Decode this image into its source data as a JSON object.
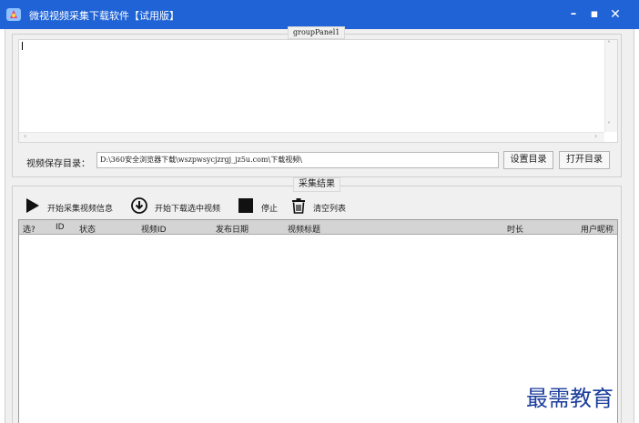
{
  "window": {
    "title": "微视视频采集下载软件【试用版】",
    "controls": {
      "minimize": "–",
      "maximize": "▪",
      "close": "✕"
    }
  },
  "group1": {
    "caption": "groupPanel1",
    "textarea_value": ""
  },
  "save_dir": {
    "label": "视频保存目录：",
    "value": "D:\\360安全浏览器下载\\wszpwsycjzrgj_jz5u.com\\下载视频\\",
    "set_button": "设置目录",
    "open_button": "打开目录"
  },
  "results": {
    "caption": "采集结果",
    "toolbar": {
      "start_collect": "开始采集视频信息",
      "start_download": "开始下载选中视频",
      "stop": "停止",
      "clear": "清空列表"
    },
    "columns": [
      "选?",
      "ID",
      "状态",
      "视频ID",
      "发布日期",
      "视频标题",
      "时长",
      "用户昵称"
    ]
  },
  "watermark": "最需教育",
  "colors": {
    "titlebar": "#1f63d6",
    "watermark": "#1b3d9c"
  },
  "icons": {
    "app": "app-logo-icon",
    "start_collect": "play-icon",
    "start_download": "download-circle-icon",
    "stop": "stop-square-icon",
    "clear": "trash-icon"
  }
}
